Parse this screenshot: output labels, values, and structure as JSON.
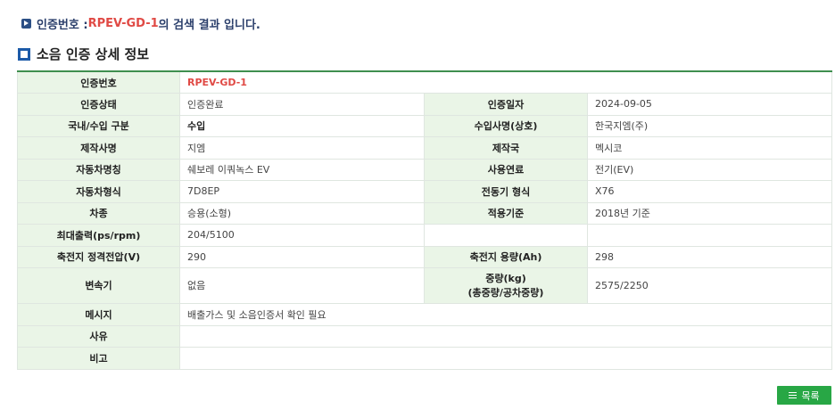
{
  "result": {
    "prefix": "인증번호 : ",
    "cert_no": "RPEV-GD-1",
    "suffix": " 의 검색 결과 입니다."
  },
  "section_title": "소음 인증 상세 정보",
  "rows": {
    "r1": {
      "l1": "인증번호",
      "v1": "RPEV-GD-1"
    },
    "r2": {
      "l1": "인증상태",
      "v1": "인증완료",
      "l2": "인증일자",
      "v2": "2024-09-05"
    },
    "r3": {
      "l1": "국내/수입 구분",
      "v1": "수입",
      "l2": "수입사명(상호)",
      "v2": "한국지엠(주)"
    },
    "r4": {
      "l1": "제작사명",
      "v1": "지엠",
      "l2": "제작국",
      "v2": "멕시코"
    },
    "r5": {
      "l1": "자동차명칭",
      "v1": "쉐보레 이쿼녹스 EV",
      "l2": "사용연료",
      "v2": "전기(EV)"
    },
    "r6": {
      "l1": "자동차형식",
      "v1": "7D8EP",
      "l2": "전동기 형식",
      "v2": "X76"
    },
    "r7": {
      "l1": "차종",
      "v1": "승용(소형)",
      "l2": "적용기준",
      "v2": "2018년 기준"
    },
    "r8": {
      "l1": "최대출력(ps/rpm)",
      "v1": "204/5100",
      "l2": "",
      "v2": ""
    },
    "r9": {
      "l1": "축전지 정격전압(V)",
      "v1": "290",
      "l2": "축전지 용량(Ah)",
      "v2": "298"
    },
    "r10": {
      "l1": "변속기",
      "v1": "없음",
      "l2a": "중량(kg)",
      "l2b": "(총중량/공차중량)",
      "v2": "2575/2250"
    },
    "r11": {
      "l1": "메시지",
      "v1": "배출가스 및 소음인증서 확인 필요"
    },
    "r12": {
      "l1": "사유",
      "v1": ""
    },
    "r13": {
      "l1": "비고",
      "v1": ""
    }
  },
  "list_button": {
    "label": "목록",
    "icon": "menu-icon"
  },
  "colors": {
    "header_bg": "#eaf5e7",
    "accent_green": "#28a745",
    "cert_red": "#e04a45"
  }
}
